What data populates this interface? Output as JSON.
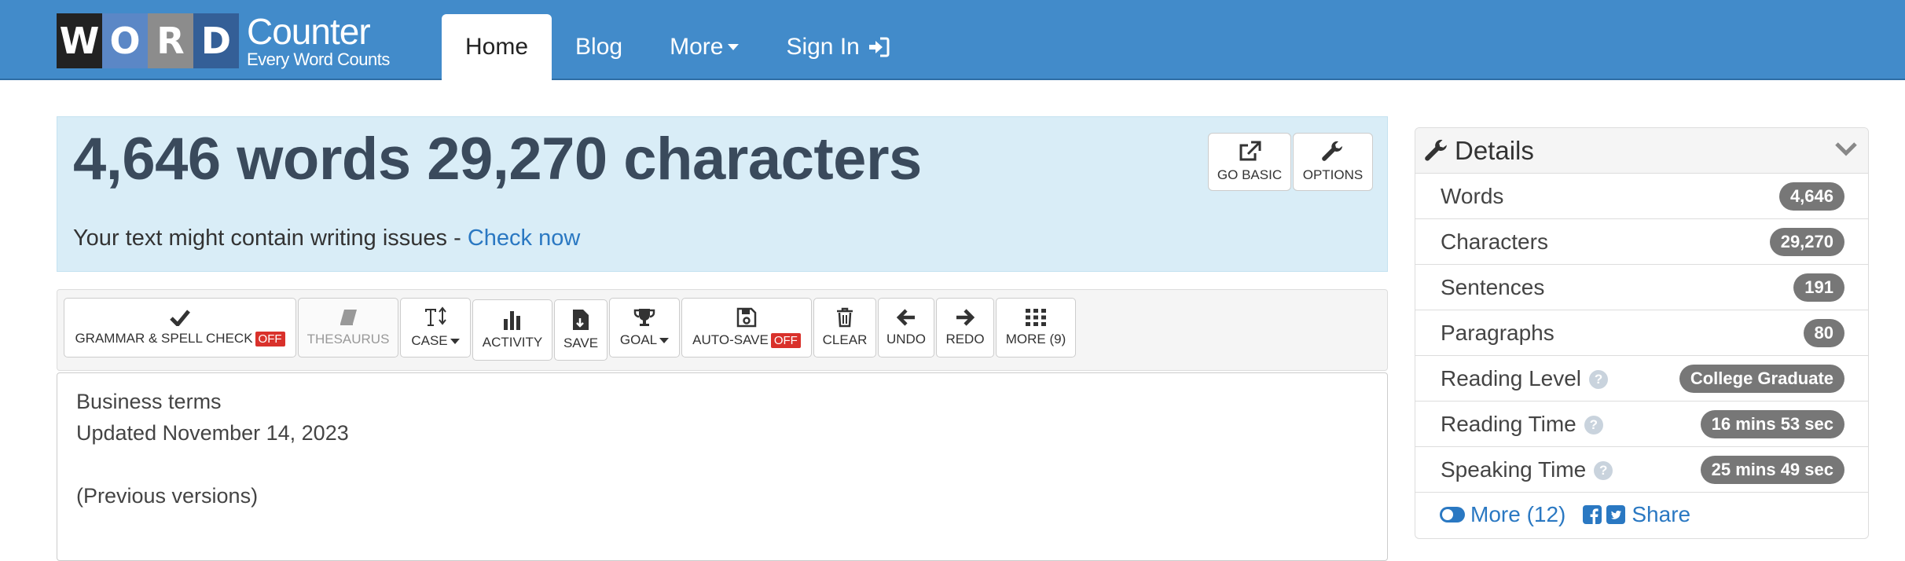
{
  "logo": {
    "tiles": [
      "W",
      "O",
      "R",
      "D"
    ],
    "brand": "Counter",
    "tagline": "Every Word Counts"
  },
  "nav": {
    "home": "Home",
    "blog": "Blog",
    "more": "More",
    "signin": "Sign In"
  },
  "hero": {
    "headline": "4,646 words 29,270 characters",
    "issues_text": "Your text might contain writing issues - ",
    "issues_link": "Check now",
    "go_basic": "GO BASIC",
    "options": "OPTIONS"
  },
  "toolbar": {
    "grammar": "GRAMMAR & SPELL CHECK",
    "grammar_state": "OFF",
    "thesaurus": "THESAURUS",
    "case": "CASE",
    "activity": "ACTIVITY",
    "save": "SAVE",
    "goal": "GOAL",
    "autosave": "AUTO-SAVE",
    "autosave_state": "OFF",
    "clear": "CLEAR",
    "undo": "UNDO",
    "redo": "REDO",
    "more": "MORE (9)"
  },
  "editor": {
    "lines": [
      "Business terms",
      "Updated November 14, 2023",
      "",
      "(Previous versions)"
    ]
  },
  "details": {
    "title": "Details",
    "rows": [
      {
        "label": "Words",
        "value": "4,646"
      },
      {
        "label": "Characters",
        "value": "29,270"
      },
      {
        "label": "Sentences",
        "value": "191"
      },
      {
        "label": "Paragraphs",
        "value": "80"
      },
      {
        "label": "Reading Level",
        "value": "College Graduate"
      },
      {
        "label": "Reading Time",
        "value": "16 mins 53 sec"
      },
      {
        "label": "Speaking Time",
        "value": "25 mins 49 sec"
      }
    ],
    "more": "More (12)",
    "share": "Share"
  },
  "colors": {
    "navbar": "#428bca",
    "hero": "#d9edf7",
    "link": "#2a78c2",
    "off": "#d9312b",
    "badge": "#777777"
  }
}
